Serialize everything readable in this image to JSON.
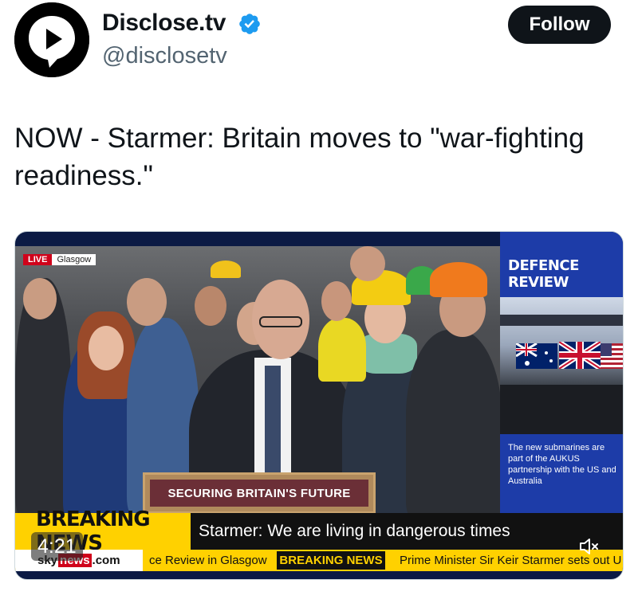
{
  "author": {
    "display_name": "Disclose.tv",
    "handle": "@disclosetv",
    "verified_icon": "verified-badge-icon",
    "avatar_icon": "play-chat-bubble-icon"
  },
  "actions": {
    "follow_label": "Follow"
  },
  "tweet": {
    "text": "NOW - Starmer: Britain moves to \"war-fighting readiness.\""
  },
  "video": {
    "live_label": "LIVE",
    "location_label": "Glasgow",
    "lectern_sign": "SECURING BRITAIN'S FUTURE",
    "side_panel_title": "DEFENCE REVIEW",
    "side_panel_caption": "The new submarines are part of the AUKUS partnership with the US and Australia",
    "breaking_label": "BREAKING NEWS",
    "headline": "Starmer: We are living in dangerous times",
    "logo_sky": "sky",
    "logo_news": "news",
    "logo_com": ".com",
    "ticker_text_1": "ce Review in Glasgow",
    "ticker_breaking": "BREAKING NEWS",
    "ticker_text_2": "Prime Minister Sir Keir Starmer sets out U",
    "duration": "4:21",
    "mute_icon": "speaker-muted-icon"
  },
  "colors": {
    "follow_bg": "#0f1419",
    "verified_blue": "#1d9bf0",
    "sky_yellow": "#ffd100",
    "sky_red": "#d0021b",
    "panel_blue": "#1d3ca8"
  }
}
